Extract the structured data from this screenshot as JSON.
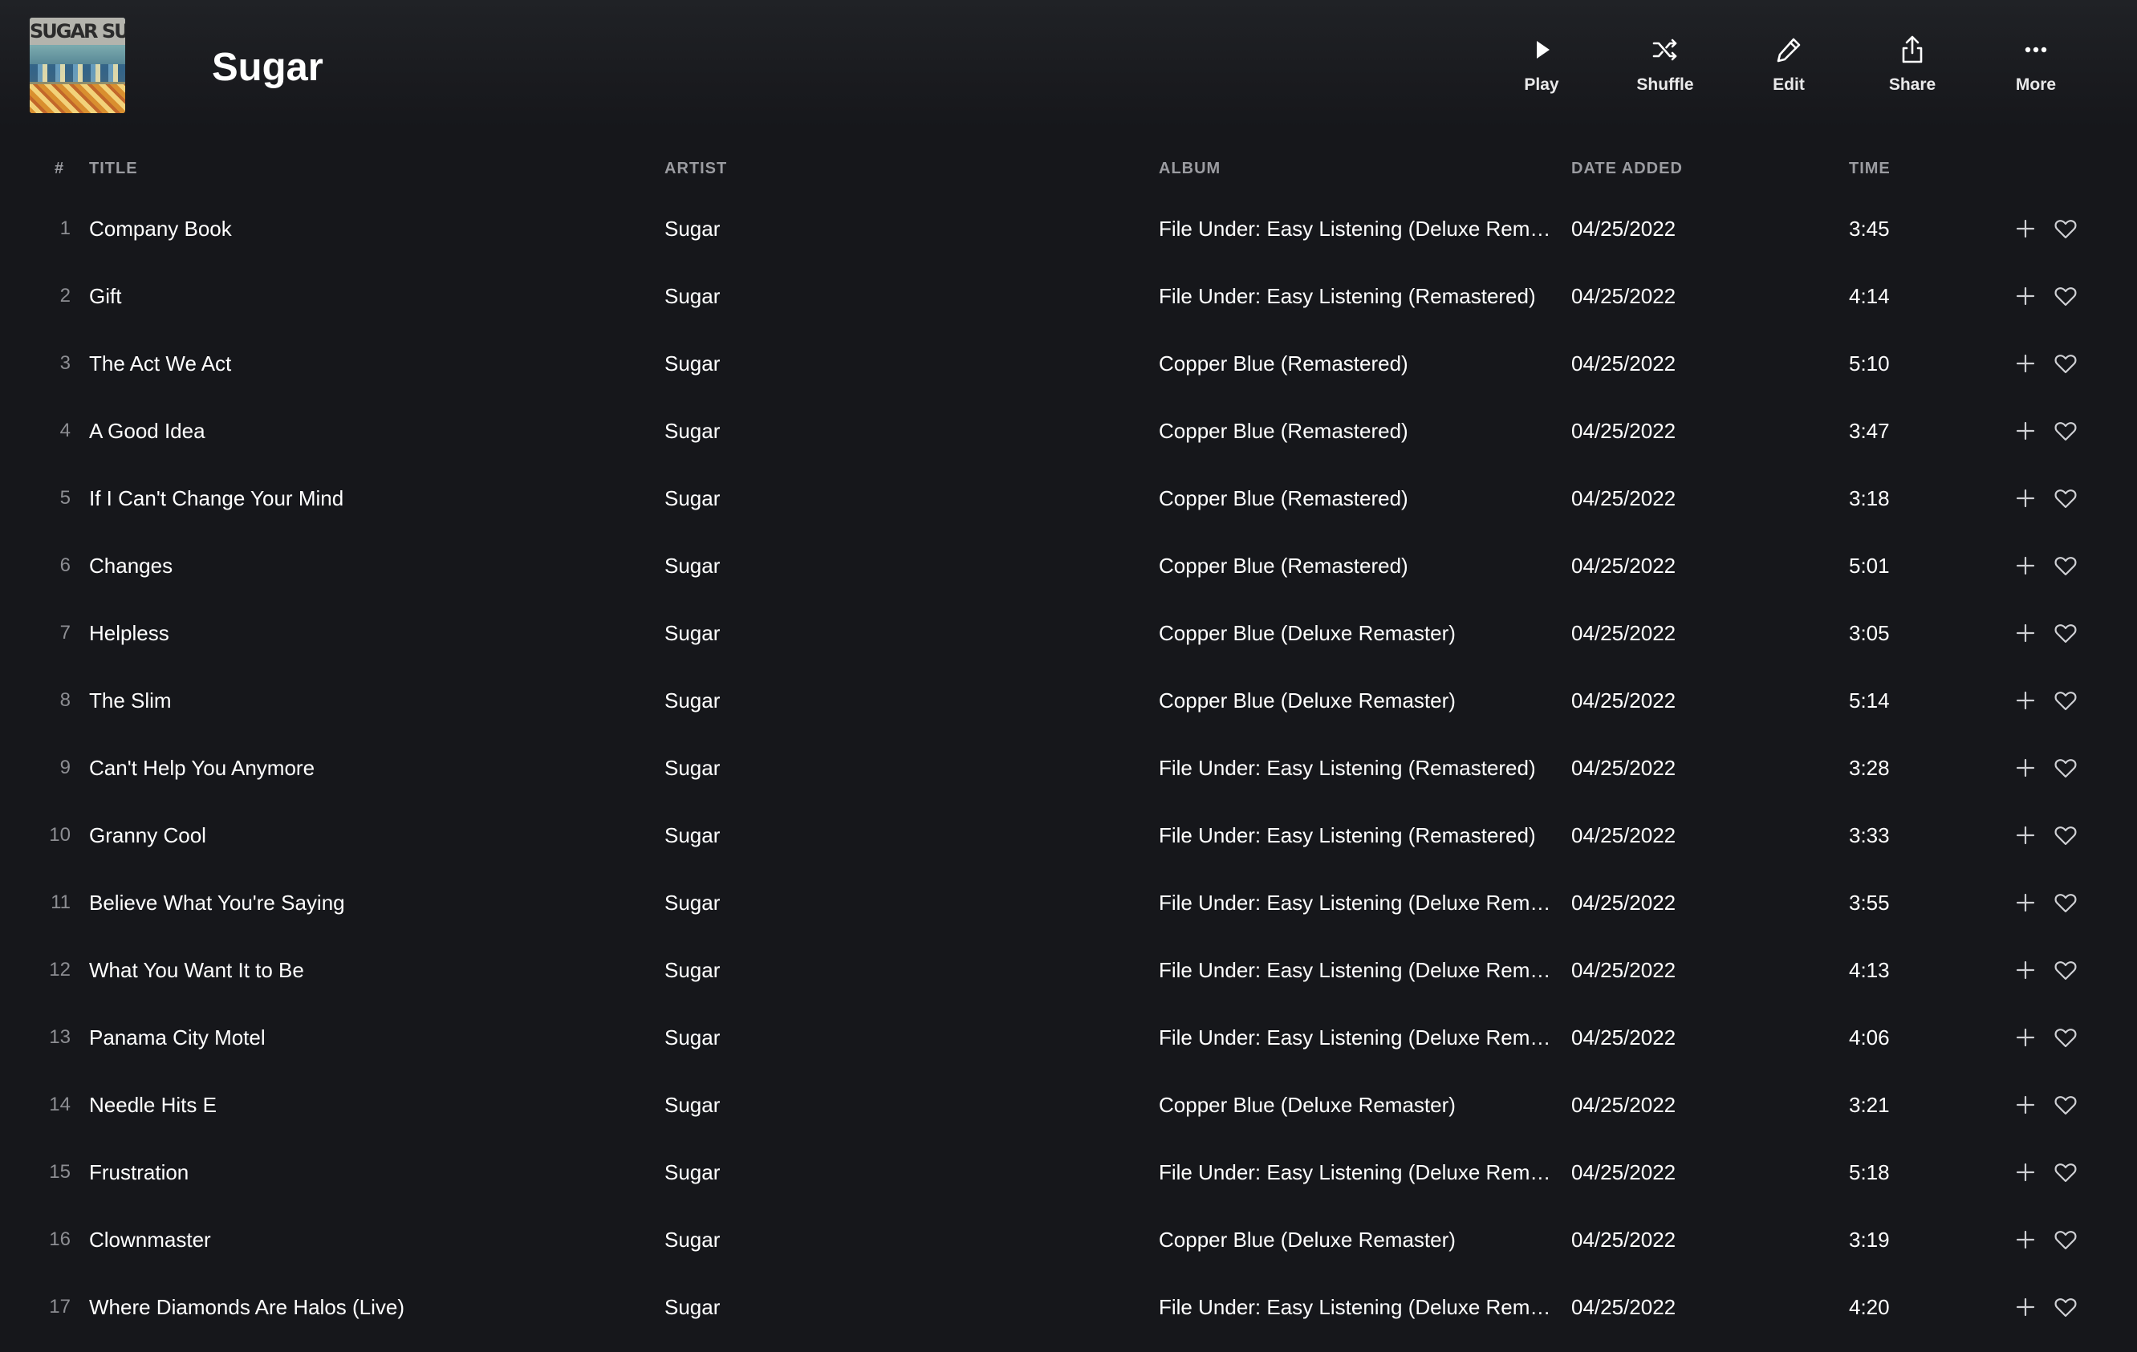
{
  "playlist": {
    "title": "Sugar",
    "art_text": "SUGAR SUGAR"
  },
  "actions": [
    {
      "key": "play",
      "label": "Play",
      "icon": "play-icon"
    },
    {
      "key": "shuffle",
      "label": "Shuffle",
      "icon": "shuffle-icon"
    },
    {
      "key": "edit",
      "label": "Edit",
      "icon": "pencil-icon"
    },
    {
      "key": "share",
      "label": "Share",
      "icon": "share-icon"
    },
    {
      "key": "more",
      "label": "More",
      "icon": "ellipsis-icon"
    }
  ],
  "columns": {
    "num": "#",
    "title": "TITLE",
    "artist": "ARTIST",
    "album": "ALBUM",
    "date_added": "DATE ADDED",
    "time": "TIME"
  },
  "row_icons": {
    "add": "plus-icon",
    "like": "heart-icon"
  },
  "tracks": [
    {
      "num": "1",
      "title": "Company Book",
      "artist": "Sugar",
      "album": "File Under: Easy Listening (Deluxe Rema...",
      "date_added": "04/25/2022",
      "time": "3:45"
    },
    {
      "num": "2",
      "title": "Gift",
      "artist": "Sugar",
      "album": "File Under: Easy Listening (Remastered)",
      "date_added": "04/25/2022",
      "time": "4:14"
    },
    {
      "num": "3",
      "title": "The Act We Act",
      "artist": "Sugar",
      "album": "Copper Blue (Remastered)",
      "date_added": "04/25/2022",
      "time": "5:10"
    },
    {
      "num": "4",
      "title": "A Good Idea",
      "artist": "Sugar",
      "album": "Copper Blue (Remastered)",
      "date_added": "04/25/2022",
      "time": "3:47"
    },
    {
      "num": "5",
      "title": "If I Can't Change Your Mind",
      "artist": "Sugar",
      "album": "Copper Blue (Remastered)",
      "date_added": "04/25/2022",
      "time": "3:18"
    },
    {
      "num": "6",
      "title": "Changes",
      "artist": "Sugar",
      "album": "Copper Blue (Remastered)",
      "date_added": "04/25/2022",
      "time": "5:01"
    },
    {
      "num": "7",
      "title": "Helpless",
      "artist": "Sugar",
      "album": "Copper Blue (Deluxe Remaster)",
      "date_added": "04/25/2022",
      "time": "3:05"
    },
    {
      "num": "8",
      "title": "The Slim",
      "artist": "Sugar",
      "album": "Copper Blue (Deluxe Remaster)",
      "date_added": "04/25/2022",
      "time": "5:14"
    },
    {
      "num": "9",
      "title": "Can't Help You Anymore",
      "artist": "Sugar",
      "album": "File Under: Easy Listening (Remastered)",
      "date_added": "04/25/2022",
      "time": "3:28"
    },
    {
      "num": "10",
      "title": "Granny Cool",
      "artist": "Sugar",
      "album": "File Under: Easy Listening (Remastered)",
      "date_added": "04/25/2022",
      "time": "3:33"
    },
    {
      "num": "11",
      "title": "Believe What You're Saying",
      "artist": "Sugar",
      "album": "File Under: Easy Listening (Deluxe Rema...",
      "date_added": "04/25/2022",
      "time": "3:55"
    },
    {
      "num": "12",
      "title": "What You Want It to Be",
      "artist": "Sugar",
      "album": "File Under: Easy Listening (Deluxe Rema...",
      "date_added": "04/25/2022",
      "time": "4:13"
    },
    {
      "num": "13",
      "title": "Panama City Motel",
      "artist": "Sugar",
      "album": "File Under: Easy Listening (Deluxe Rema...",
      "date_added": "04/25/2022",
      "time": "4:06"
    },
    {
      "num": "14",
      "title": "Needle Hits E",
      "artist": "Sugar",
      "album": "Copper Blue (Deluxe Remaster)",
      "date_added": "04/25/2022",
      "time": "3:21"
    },
    {
      "num": "15",
      "title": "Frustration",
      "artist": "Sugar",
      "album": "File Under: Easy Listening (Deluxe Rema...",
      "date_added": "04/25/2022",
      "time": "5:18"
    },
    {
      "num": "16",
      "title": "Clownmaster",
      "artist": "Sugar",
      "album": "Copper Blue (Deluxe Remaster)",
      "date_added": "04/25/2022",
      "time": "3:19"
    },
    {
      "num": "17",
      "title": "Where Diamonds Are Halos (Live)",
      "artist": "Sugar",
      "album": "File Under: Easy Listening (Deluxe Rema...",
      "date_added": "04/25/2022",
      "time": "4:20"
    }
  ]
}
